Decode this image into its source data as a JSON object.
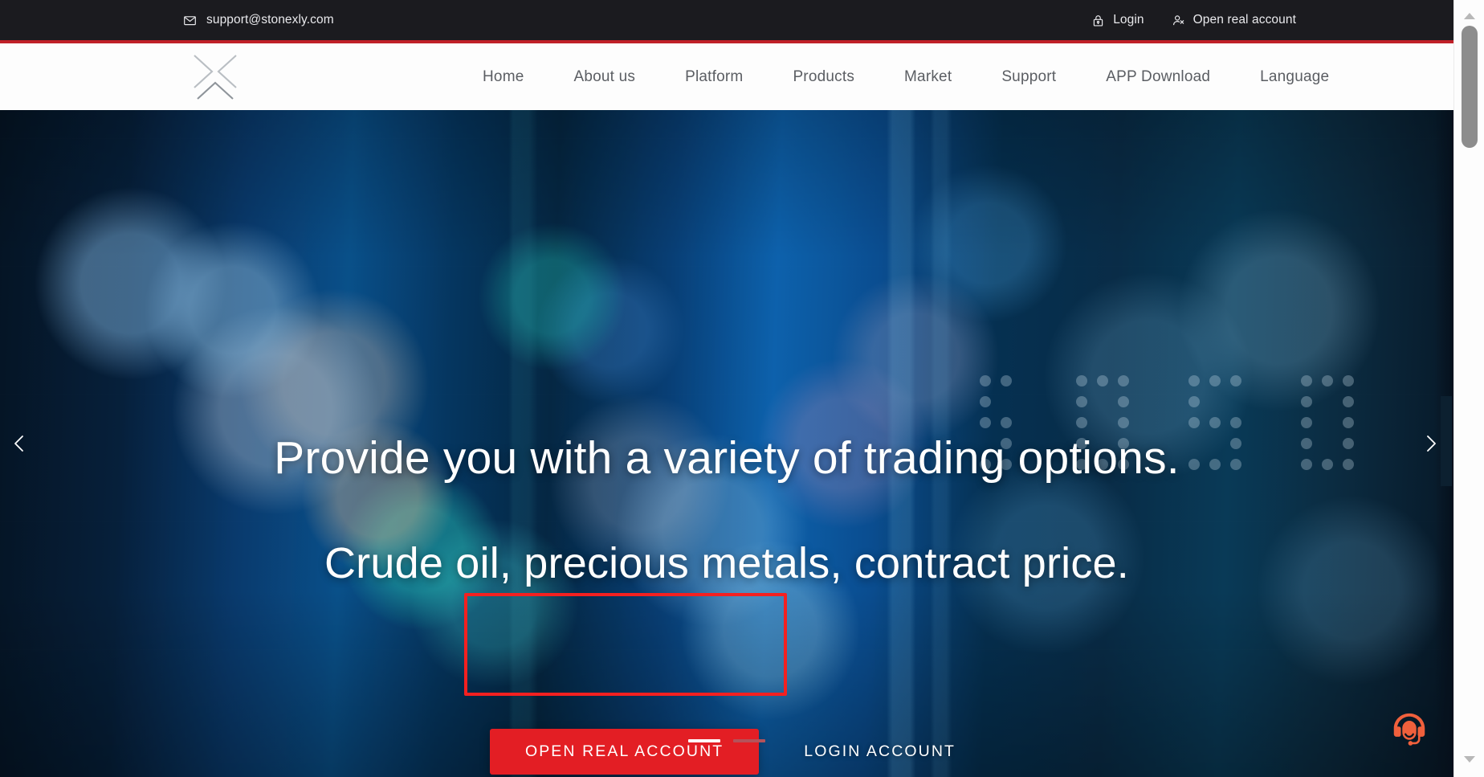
{
  "topbar": {
    "email": "support@stonexly.com",
    "email_icon": "mail-icon",
    "login_label": "Login",
    "login_icon": "lock-icon",
    "open_account_label": "Open real account",
    "open_account_icon": "user-plus-icon",
    "background_color": "#1b1b1f",
    "accent_rule_color": "#c02028"
  },
  "nav": {
    "logo_name": "stonexly-x-logo",
    "links": [
      {
        "label": "Home"
      },
      {
        "label": "About us"
      },
      {
        "label": "Platform"
      },
      {
        "label": "Products"
      },
      {
        "label": "Market"
      },
      {
        "label": "Support"
      },
      {
        "label": "APP Download"
      },
      {
        "label": "Language"
      }
    ]
  },
  "hero": {
    "title": "Provide you with a variety of trading options.",
    "subtitle": "Crude oil, precious metals, contract price.",
    "primary_cta": "OPEN REAL ACCOUNT",
    "secondary_cta": "LOGIN ACCOUNT",
    "primary_cta_color": "#e31e24",
    "prev_arrow_icon": "chevron-left-icon",
    "next_arrow_icon": "chevron-right-icon",
    "slides": [
      {
        "active": true
      },
      {
        "active": false
      }
    ],
    "annotation_box_color": "#f42020"
  },
  "chat": {
    "icon": "headset-support-icon",
    "color": "#f0603c"
  },
  "scrollbar": {
    "up_icon": "scroll-up-arrow-icon",
    "down_icon": "scroll-down-arrow-icon",
    "thumb_color": "#8d8d8d"
  }
}
